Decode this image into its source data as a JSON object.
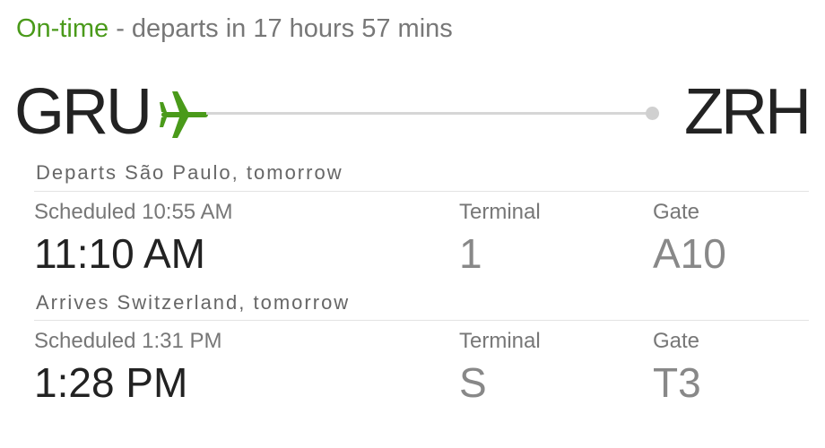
{
  "status": {
    "state": "On-time",
    "detail": " - departs in 17 hours 57 mins",
    "state_color": "#4a9a1a"
  },
  "route": {
    "origin": "GRU",
    "destination": "ZRH",
    "icon": "airplane-icon",
    "accent_color": "#4a9a1a"
  },
  "departure": {
    "title": "Departs São Paulo, tomorrow",
    "scheduled": "Scheduled 10:55 AM",
    "time": "11:10 AM",
    "terminal_label": "Terminal",
    "terminal": "1",
    "gate_label": "Gate",
    "gate": "A10"
  },
  "arrival": {
    "title": "Arrives Switzerland, tomorrow",
    "scheduled": "Scheduled 1:31 PM",
    "time": "1:28 PM",
    "terminal_label": "Terminal",
    "terminal": "S",
    "gate_label": "Gate",
    "gate": "T3"
  }
}
